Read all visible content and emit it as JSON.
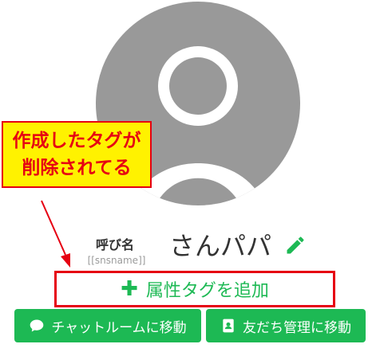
{
  "callout": {
    "line1": "作成したタグが",
    "line2": "削除されてる"
  },
  "profile": {
    "name_label": "呼び名",
    "name_variable": "[[snsname]]",
    "name_value": "さんパパ"
  },
  "tag_button": {
    "icon": "plus-icon",
    "label": "属性タグを追加"
  },
  "actions": {
    "chat_label": "チャットルームに移動",
    "chat_icon": "speech-bubble-icon",
    "friend_label": "友だち管理に移動",
    "friend_icon": "address-book-icon"
  },
  "colors": {
    "avatar": "#999999",
    "green": "#1db954",
    "callout_bg": "#fff200",
    "callout_text": "#e60012",
    "highlight_border": "#e60012"
  }
}
